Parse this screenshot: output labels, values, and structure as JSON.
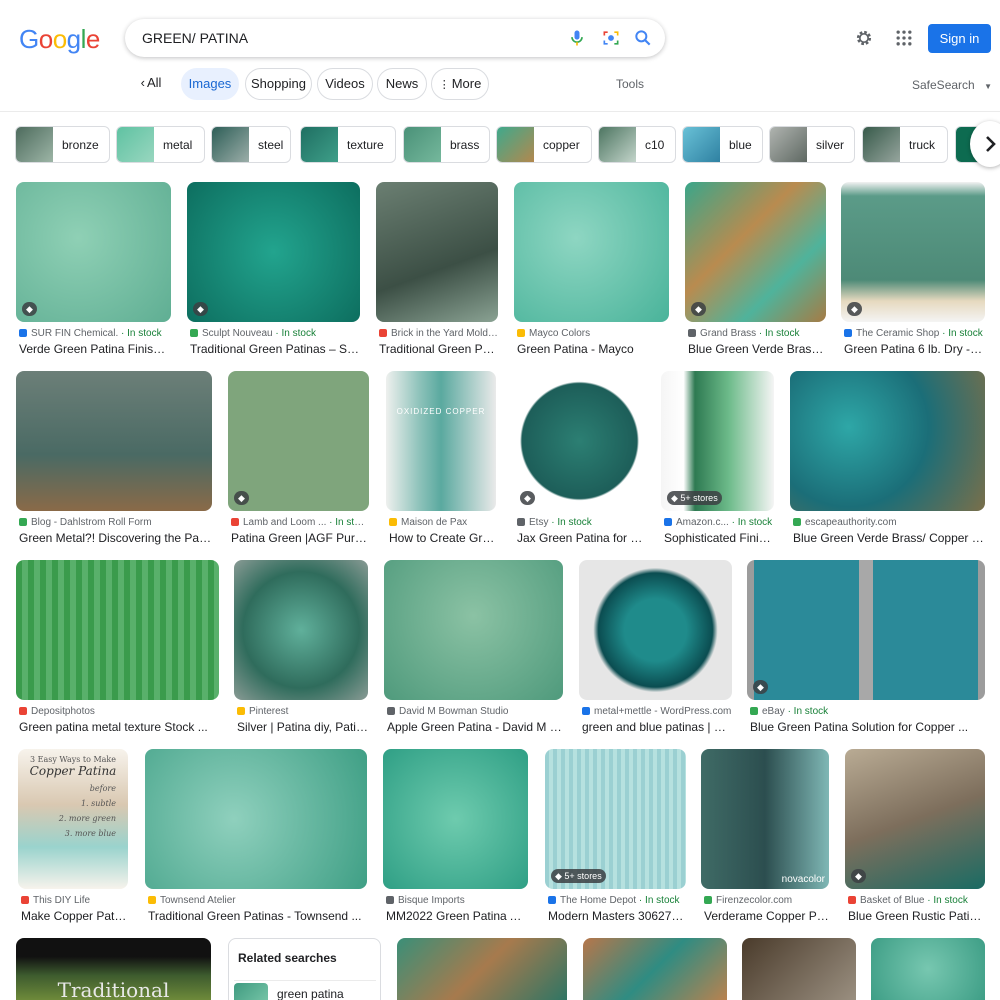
{
  "logo": {
    "letters": [
      "G",
      "o",
      "o",
      "g",
      "l",
      "e"
    ],
    "colors": [
      "#4285f4",
      "#ea4335",
      "#fbbc05",
      "#4285f4",
      "#34a853",
      "#ea4335"
    ]
  },
  "search": {
    "query": "GREEN/ PATINA"
  },
  "header": {
    "sign_in": "Sign in",
    "accent": "#1a73e8"
  },
  "tabs": [
    {
      "label": "All",
      "active": false
    },
    {
      "label": "Images",
      "active": true
    },
    {
      "label": "Shopping",
      "active": false
    },
    {
      "label": "Videos",
      "active": false
    },
    {
      "label": "News",
      "active": false
    },
    {
      "label": "More",
      "active": false
    }
  ],
  "tools": "Tools",
  "safesearch": "SafeSearch",
  "chips": [
    "bronze",
    "metal",
    "steel",
    "texture",
    "brass",
    "copper",
    "c10",
    "blue",
    "silver",
    "truck"
  ],
  "results": [
    {
      "source": "SUR FIN Chemical.",
      "stock": "In stock",
      "title": "Verde Green Patina Finish o...",
      "tag": ""
    },
    {
      "source": "Sculpt Nouveau",
      "stock": "In stock",
      "title": "Traditional Green Patinas – Scu...",
      "tag": ""
    },
    {
      "source": "Brick in the Yard Mold ...",
      "stock": "",
      "title": "Traditional Green Pati...",
      "tag": null
    },
    {
      "source": "Mayco Colors",
      "stock": "",
      "title": "Green Patina - Mayco",
      "tag": null
    },
    {
      "source": "Grand Brass",
      "stock": "In stock",
      "title": "Blue Green Verde Brass/ ...",
      "tag": ""
    },
    {
      "source": "The Ceramic Shop",
      "stock": "In stock",
      "title": "Green Patina 6 lb. Dry - T...",
      "tag": ""
    },
    {
      "source": "Blog - Dahlstrom Roll Form",
      "stock": "",
      "title": "Green Metal?! Discovering the Patin...",
      "tag": null
    },
    {
      "source": "Lamb and Loom ...",
      "stock": "In stock",
      "title": "Patina Green |AGF Pure S...",
      "tag": ""
    },
    {
      "source": "Maison de Pax",
      "stock": "",
      "title": "How to Create Gree...",
      "tag": null
    },
    {
      "source": "Etsy",
      "stock": "In stock",
      "title": "Jax Green Patina for C...",
      "tag": ""
    },
    {
      "source": "Amazon.c...",
      "stock": "In stock",
      "title": "Sophisticated Finis...",
      "tag": "5+ stores"
    },
    {
      "source": "escapeauthority.com",
      "stock": "",
      "title": "Blue Green Verde Brass/ Copper Pat...",
      "tag": null
    },
    {
      "source": "Depositphotos",
      "stock": "",
      "title": "Green patina metal texture Stock ...",
      "tag": null
    },
    {
      "source": "Pinterest",
      "stock": "",
      "title": "Silver | Patina diy, Patin...",
      "tag": null
    },
    {
      "source": "David M Bowman Studio",
      "stock": "",
      "title": "Apple Green Patina - David M Bo...",
      "tag": null
    },
    {
      "source": "metal+mettle - WordPress.com",
      "stock": "",
      "title": "green and blue patinas | me...",
      "tag": null
    },
    {
      "source": "eBay",
      "stock": "In stock",
      "title": "Blue Green Patina Solution for Copper ...",
      "tag": ""
    },
    {
      "source": "This DIY Life",
      "stock": "",
      "title": "Make Copper Patin...",
      "tag": null
    },
    {
      "source": "Townsend Atelier",
      "stock": "",
      "title": "Traditional Green Patinas - Townsend ...",
      "tag": null
    },
    {
      "source": "Bisque Imports",
      "stock": "",
      "title": "MM2022 Green Patina Acr...",
      "tag": null
    },
    {
      "source": "The Home Depot",
      "stock": "In stock",
      "title": "Modern Masters 306270 ...",
      "tag": "5+ stores"
    },
    {
      "source": "Firenzecolor.com",
      "stock": "",
      "title": "Verderame Copper Pai...",
      "tag": null
    },
    {
      "source": "Basket of Blue",
      "stock": "In stock",
      "title": "Blue Green Rustic Patina ...",
      "tag": ""
    }
  ],
  "image_text": {
    "diy_title": "3 Easy Ways to Make",
    "diy_script": "Copper Patina",
    "diy_steps": [
      "before",
      "1. subtle",
      "2. more green",
      "3. more blue"
    ],
    "oxidized": "OXIDIZED COPPER",
    "bottom_book": "Traditional",
    "watermark": "novacolor"
  },
  "related": {
    "heading": "Related searches",
    "item": "green patina"
  }
}
